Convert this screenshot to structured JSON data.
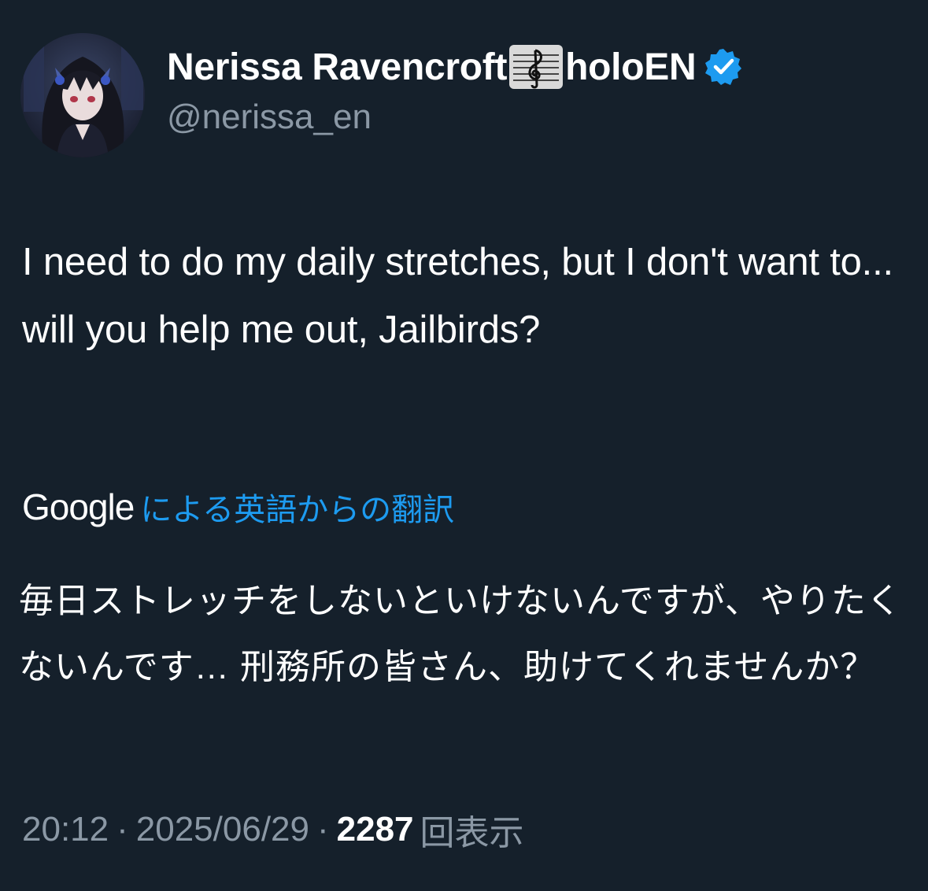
{
  "author": {
    "display_name": "Nerissa Ravencroft",
    "display_name_emoji": "music-score-emoji",
    "display_name_suffix": "holoEN",
    "verified": true,
    "handle": "@nerissa_en"
  },
  "tweet": {
    "text": "I need to do my daily stretches, but I don't want to... will you help me out, Jailbirds?"
  },
  "translation": {
    "provider": "Google",
    "label": "による英語からの翻訳",
    "text": "毎日ストレッチをしないといけないんですが、やりたくないんです… 刑務所の皆さん、助けてくれませんか？"
  },
  "meta": {
    "time": "20:12",
    "separator": "·",
    "date": "2025/06/29",
    "views": "2287",
    "views_label": "回表示"
  },
  "colors": {
    "background": "#15202b",
    "link": "#1d9bf0",
    "secondary_text": "#8b98a5",
    "verified_badge": "#1d9bf0"
  }
}
